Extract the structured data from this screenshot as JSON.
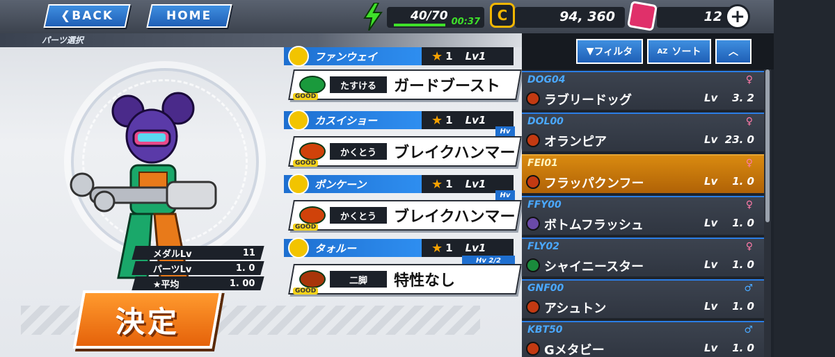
{
  "header": {
    "back_label": "BACK",
    "home_label": "HOME",
    "stamina": "40/70",
    "stamina_timer": "00:37",
    "coins": "94, 360",
    "gems": "12"
  },
  "section_title": "パーツ選択",
  "medal_stats": [
    {
      "label": "メダルLv",
      "value": "11"
    },
    {
      "label": "パーツLv",
      "value": "1. 0"
    },
    {
      "label": "★平均",
      "value": "1. 00"
    }
  ],
  "decide_label": "決定",
  "parts": [
    {
      "name": "ファンウェイ",
      "stars": "1",
      "lv": "Lv1",
      "skill_type": "たすける",
      "skill_name": "ガードブースト",
      "good": "GOOD",
      "badge": ""
    },
    {
      "name": "カスイショー",
      "stars": "1",
      "lv": "Lv1",
      "skill_type": "かくとう",
      "skill_name": "ブレイクハンマー",
      "good": "GOOD",
      "badge": "Hv"
    },
    {
      "name": "ポンケーン",
      "stars": "1",
      "lv": "Lv1",
      "skill_type": "かくとう",
      "skill_name": "ブレイクハンマー",
      "good": "GOOD",
      "badge": "Hv"
    },
    {
      "name": "タォルー",
      "stars": "1",
      "lv": "Lv1",
      "skill_type": "二脚",
      "skill_name": "特性なし",
      "good": "GOOD",
      "badge": "Hv 2/2"
    }
  ],
  "list_controls": {
    "filter_label": "フィルタ",
    "sort_label": "ソート",
    "sort_prefix": "AZ"
  },
  "medals": [
    {
      "code": "DOG04",
      "name": "ラブリードッグ",
      "lv_label": "Lv",
      "lv": "3. 2",
      "gender": "♀",
      "selected": false
    },
    {
      "code": "DOL00",
      "name": "オランピア",
      "lv_label": "Lv",
      "lv": "23. 0",
      "gender": "♀",
      "selected": false
    },
    {
      "code": "FEI01",
      "name": "フラッパクンフー",
      "lv_label": "Lv",
      "lv": "1. 0",
      "gender": "♀",
      "selected": true
    },
    {
      "code": "FFY00",
      "name": "ボトムフラッシュ",
      "lv_label": "Lv",
      "lv": "1. 0",
      "gender": "♀",
      "selected": false
    },
    {
      "code": "FLY02",
      "name": "シャイニースター",
      "lv_label": "Lv",
      "lv": "1. 0",
      "gender": "♀",
      "selected": false
    },
    {
      "code": "GNF00",
      "name": "アシュトン",
      "lv_label": "Lv",
      "lv": "1. 0",
      "gender": "♂",
      "selected": false
    },
    {
      "code": "KBT50",
      "name": "Gメタビー",
      "lv_label": "Lv",
      "lv": "1. 0",
      "gender": "♂",
      "selected": false
    }
  ],
  "colors": {
    "accent_blue": "#2e8ef0",
    "selected_orange": "#d98a10",
    "female": "#ff7aa8",
    "male": "#4aa8ff"
  }
}
